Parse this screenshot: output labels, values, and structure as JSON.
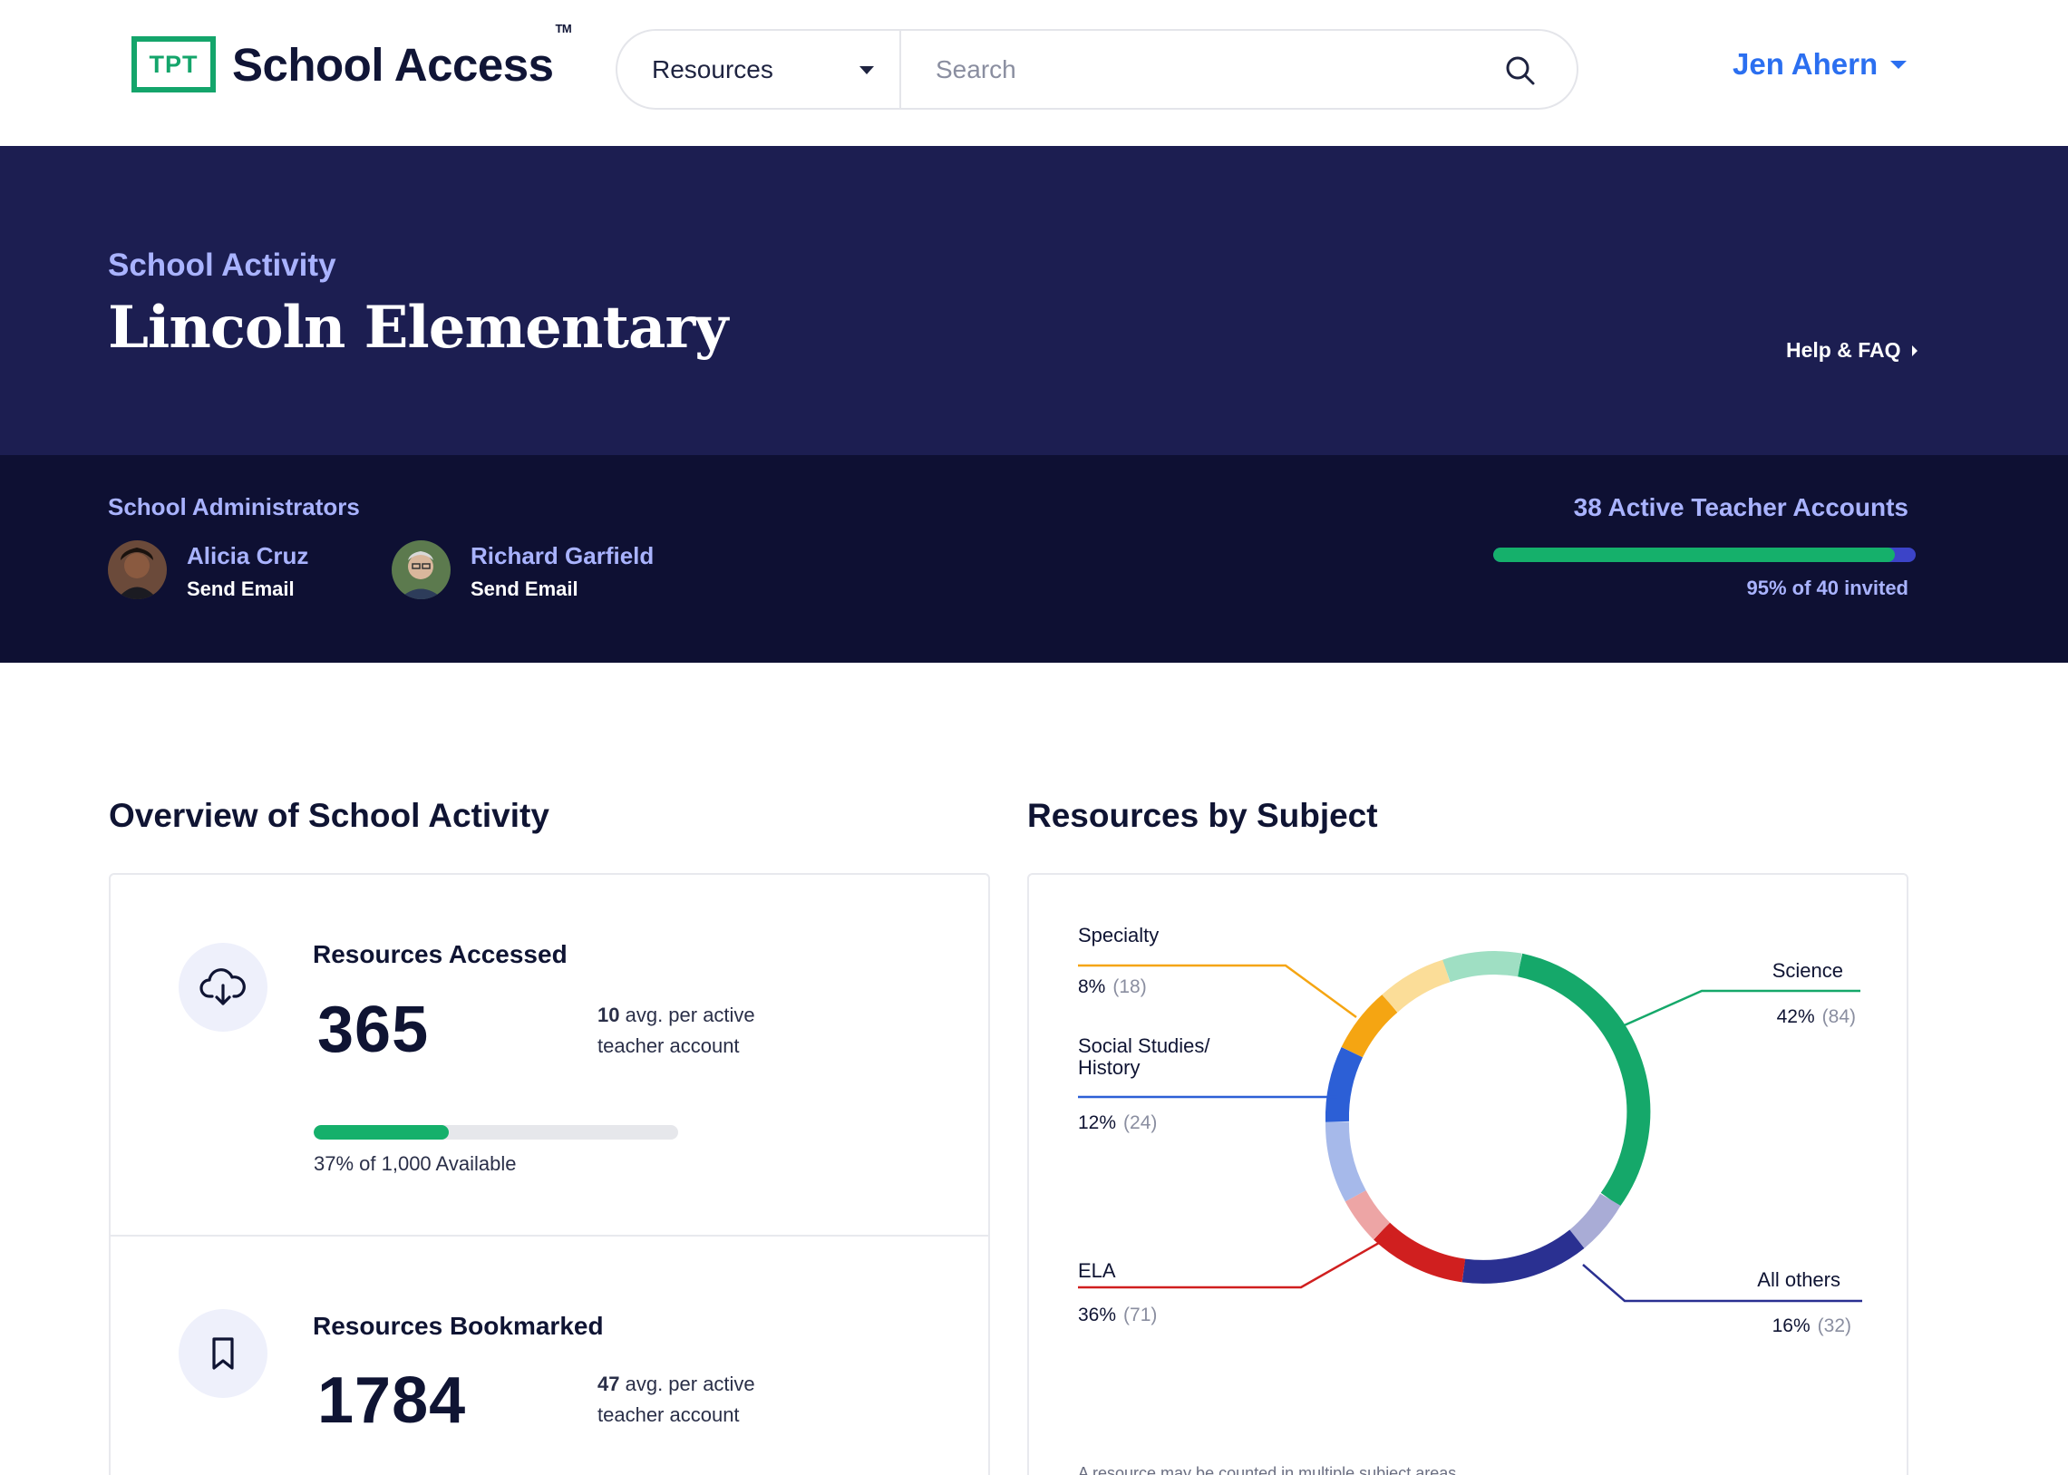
{
  "header": {
    "logo_mark": "TPT",
    "logo_text": "School Access",
    "logo_tm": "TM",
    "search_category": "Resources",
    "search_placeholder": "Search",
    "user_name": "Jen Ahern"
  },
  "hero": {
    "eyebrow": "School Activity",
    "title": "Lincoln Elementary",
    "help_link": "Help & FAQ"
  },
  "admins": {
    "label": "School Administrators",
    "people": [
      {
        "name": "Alicia Cruz",
        "action": "Send Email"
      },
      {
        "name": "Richard Garfield",
        "action": "Send Email"
      }
    ],
    "teachers_title": "38 Active Teacher Accounts",
    "teachers_fraction": 0.95,
    "teachers_sub": "95% of 40 invited"
  },
  "overview": {
    "title": "Overview of School Activity",
    "accessed": {
      "label": "Resources Accessed",
      "value": "365",
      "avg_num": "10",
      "avg_text": " avg. per active teacher account",
      "progress_fraction": 0.37,
      "progress_label": "37% of 1,000 Available"
    },
    "bookmarked": {
      "label": "Resources Bookmarked",
      "value": "1784",
      "avg_num": "47",
      "avg_text": " avg. per active teacher account"
    }
  },
  "subjects": {
    "title": "Resources by Subject",
    "footnote": "A resource may be counted in multiple subject areas",
    "items": [
      {
        "label": "Specialty",
        "pct": "8%",
        "count": "(18)"
      },
      {
        "label": "Social Studies/ History",
        "pct": "12%",
        "count": "(24)"
      },
      {
        "label": "ELA",
        "pct": "36%",
        "count": "(71)"
      },
      {
        "label": "Science",
        "pct": "42%",
        "count": "(84)"
      },
      {
        "label": "All others",
        "pct": "16%",
        "count": "(32)"
      }
    ],
    "colors": {
      "science": "#15a86a",
      "specialty": "#f5a512",
      "social": "#2c5fd6",
      "ela": "#d01f1f",
      "others": "#2a3091"
    }
  }
}
